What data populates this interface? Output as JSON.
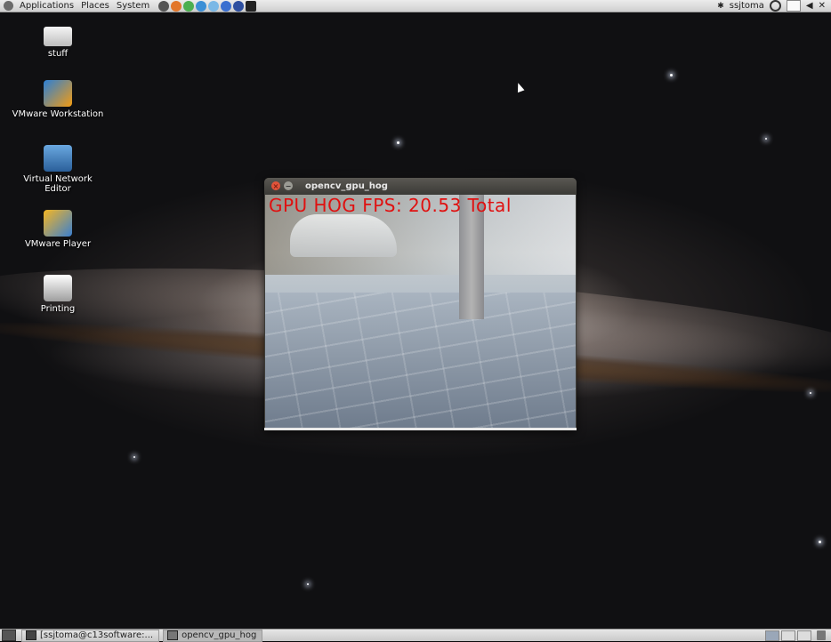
{
  "top_panel": {
    "menus": [
      "Applications",
      "Places",
      "System"
    ],
    "user": "ssjtoma"
  },
  "desktop_icons": [
    {
      "label": "stuff",
      "icon": "drive-icon"
    },
    {
      "label": "VMware Workstation",
      "icon": "vmware-workstation-icon"
    },
    {
      "label": "Virtual Network Editor",
      "icon": "network-editor-icon"
    },
    {
      "label": "VMware Player",
      "icon": "vmware-player-icon"
    },
    {
      "label": "Printing",
      "icon": "printer-icon"
    }
  ],
  "window": {
    "title": "opencv_gpu_hog",
    "overlay_text": "GPU HOG FPS: 20.53   Total"
  },
  "taskbar": {
    "tasks": [
      "[ssjtoma@c13software:...",
      "opencv_gpu_hog"
    ]
  },
  "colors": {
    "overlay_text": "#e01010",
    "panel": "#dcdcdc",
    "titlebar": "#3c3b37"
  }
}
